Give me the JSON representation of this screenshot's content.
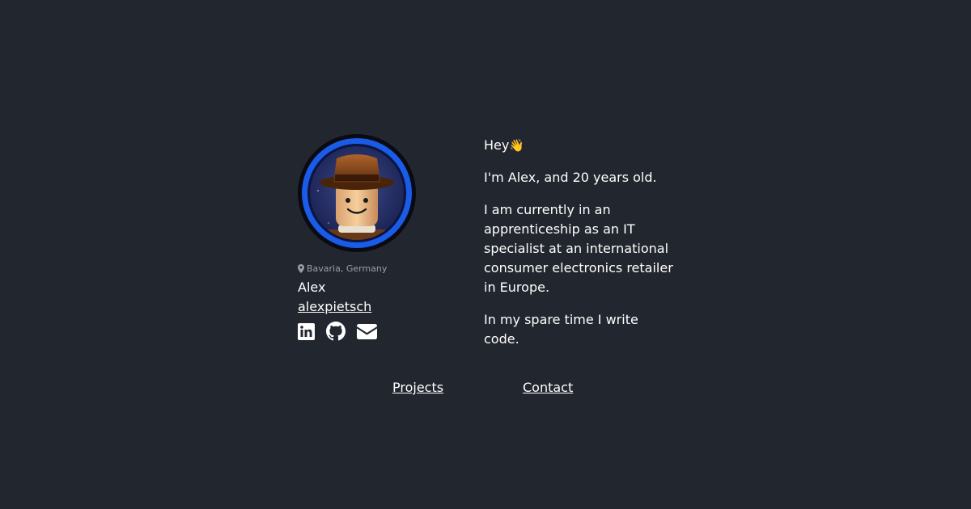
{
  "profile": {
    "avatar_alt": "LEGO minifigure avatar",
    "location": "Bavaria, Germany",
    "name": "Alex",
    "handle": "alexpietsch",
    "location_icon": "map-marker-icon",
    "socials": [
      {
        "name": "LinkedIn",
        "icon": "linkedin-icon"
      },
      {
        "name": "GitHub",
        "icon": "github-icon"
      },
      {
        "name": "Email",
        "icon": "envelope-icon"
      }
    ]
  },
  "intro": {
    "greeting": "Hey",
    "wave_emoji": "👋",
    "paragraph_1": "I'm Alex, and 20 years old.",
    "paragraph_2": "I am currently in an apprenticeship as an IT specialist at an international consumer electronics retailer in Europe.",
    "paragraph_3": "In my spare time I write code."
  },
  "nav": {
    "projects": "Projects",
    "contact": "Contact"
  },
  "colors": {
    "background": "#22262e",
    "avatar_ring": "#1a5be8",
    "text": "#ffffff",
    "muted": "#9aa0a8"
  }
}
